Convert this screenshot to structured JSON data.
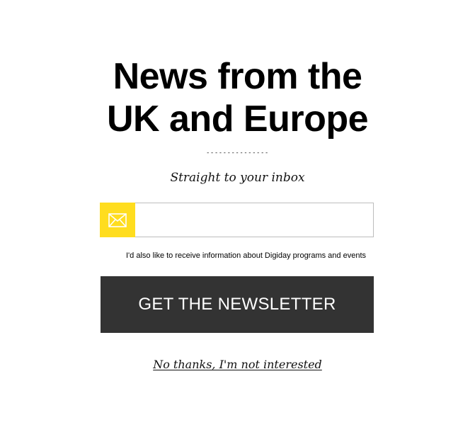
{
  "modal": {
    "headline_line1": "News from the",
    "headline_line2": "UK and Europe",
    "divider": "---------------",
    "tagline": "Straight to your inbox",
    "email_field": {
      "value": "",
      "placeholder": "",
      "icon": "envelope-icon"
    },
    "consent_text": "I'd also like to receive information about Digiday programs and events",
    "cta_label": "GET THE NEWSLETTER",
    "decline_label": "No thanks, I'm not interested"
  },
  "colors": {
    "accent_yellow": "#ffdd1f",
    "button_bg": "#333333",
    "button_text": "#ffffff",
    "input_border": "#bdbdbd"
  }
}
